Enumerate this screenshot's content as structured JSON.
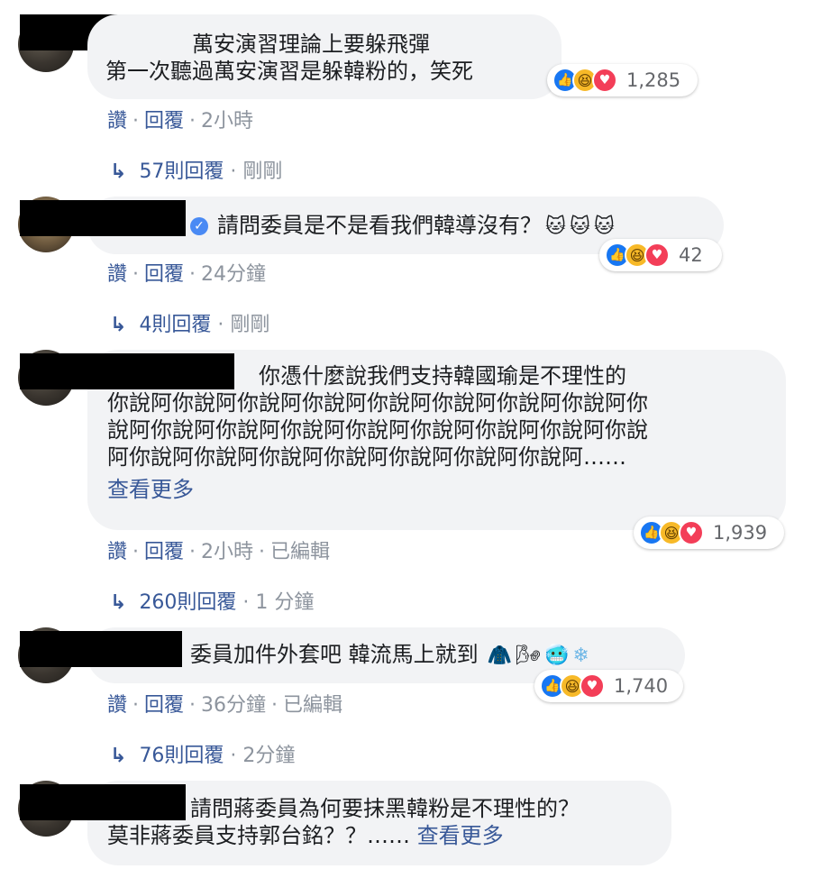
{
  "comments": [
    {
      "text_lines": [
        "萬安演習理論上要躲飛彈",
        "第一次聽過萬安演習是躲韓粉的，笑死"
      ],
      "name_tail": "",
      "reactions": {
        "count": "1,285"
      },
      "actions": {
        "like": "讚",
        "reply": "回覆",
        "time": "2小時",
        "edited": ""
      },
      "replies": {
        "label": "57則回覆",
        "time": "剛剛"
      }
    },
    {
      "text_lines": [
        "請問委員是不是看我們韓導沒有？"
      ],
      "emojis": [
        "🐱",
        "🐱",
        "🐱"
      ],
      "reactions": {
        "count": "42"
      },
      "actions": {
        "like": "讚",
        "reply": "回覆",
        "time": "24分鐘",
        "edited": ""
      },
      "replies": {
        "label": "4則回覆",
        "time": "剛剛"
      }
    },
    {
      "text_lines": [
        "你憑什麼說我們支持韓國瑜是不理性的",
        "你說阿你說阿你說阿你說阿你說阿你說阿你說阿你說阿你",
        "說阿你說阿你說阿你說阿你說阿你說阿你說阿你說阿你說",
        "阿你說阿你說阿你說阿你說阿你說阿你說阿你說阿……"
      ],
      "see_more": "查看更多",
      "reactions": {
        "count": "1,939"
      },
      "actions": {
        "like": "讚",
        "reply": "回覆",
        "time": "2小時",
        "edited": "已編輯"
      },
      "replies": {
        "label": "260則回覆",
        "time": "1 分鐘"
      }
    },
    {
      "text_lines": [
        "委員加件外套吧 韓流馬上就到"
      ],
      "emojis": [
        "🧥",
        "🌬",
        "🥶",
        "❄"
      ],
      "reactions": {
        "count": "1,740"
      },
      "actions": {
        "like": "讚",
        "reply": "回覆",
        "time": "36分鐘",
        "edited": "已編輯"
      },
      "replies": {
        "label": "76則回覆",
        "time": "2分鐘"
      }
    },
    {
      "text_lines": [
        "請問蔣委員為何要抹黑韓粉是不理性的？",
        "莫非蔣委員支持郭台銘？？……"
      ],
      "see_more": "查看更多"
    }
  ],
  "colors": {
    "link": "#385898",
    "muted": "#8d949e",
    "bubble": "#f2f3f5",
    "like": "#1877f2",
    "haha": "#f7b928",
    "love": "#f33e58",
    "verified": "#4a8af4"
  },
  "icons": [
    "like-icon",
    "haha-icon",
    "love-icon",
    "reply-arrow-icon",
    "verified-badge-icon"
  ]
}
